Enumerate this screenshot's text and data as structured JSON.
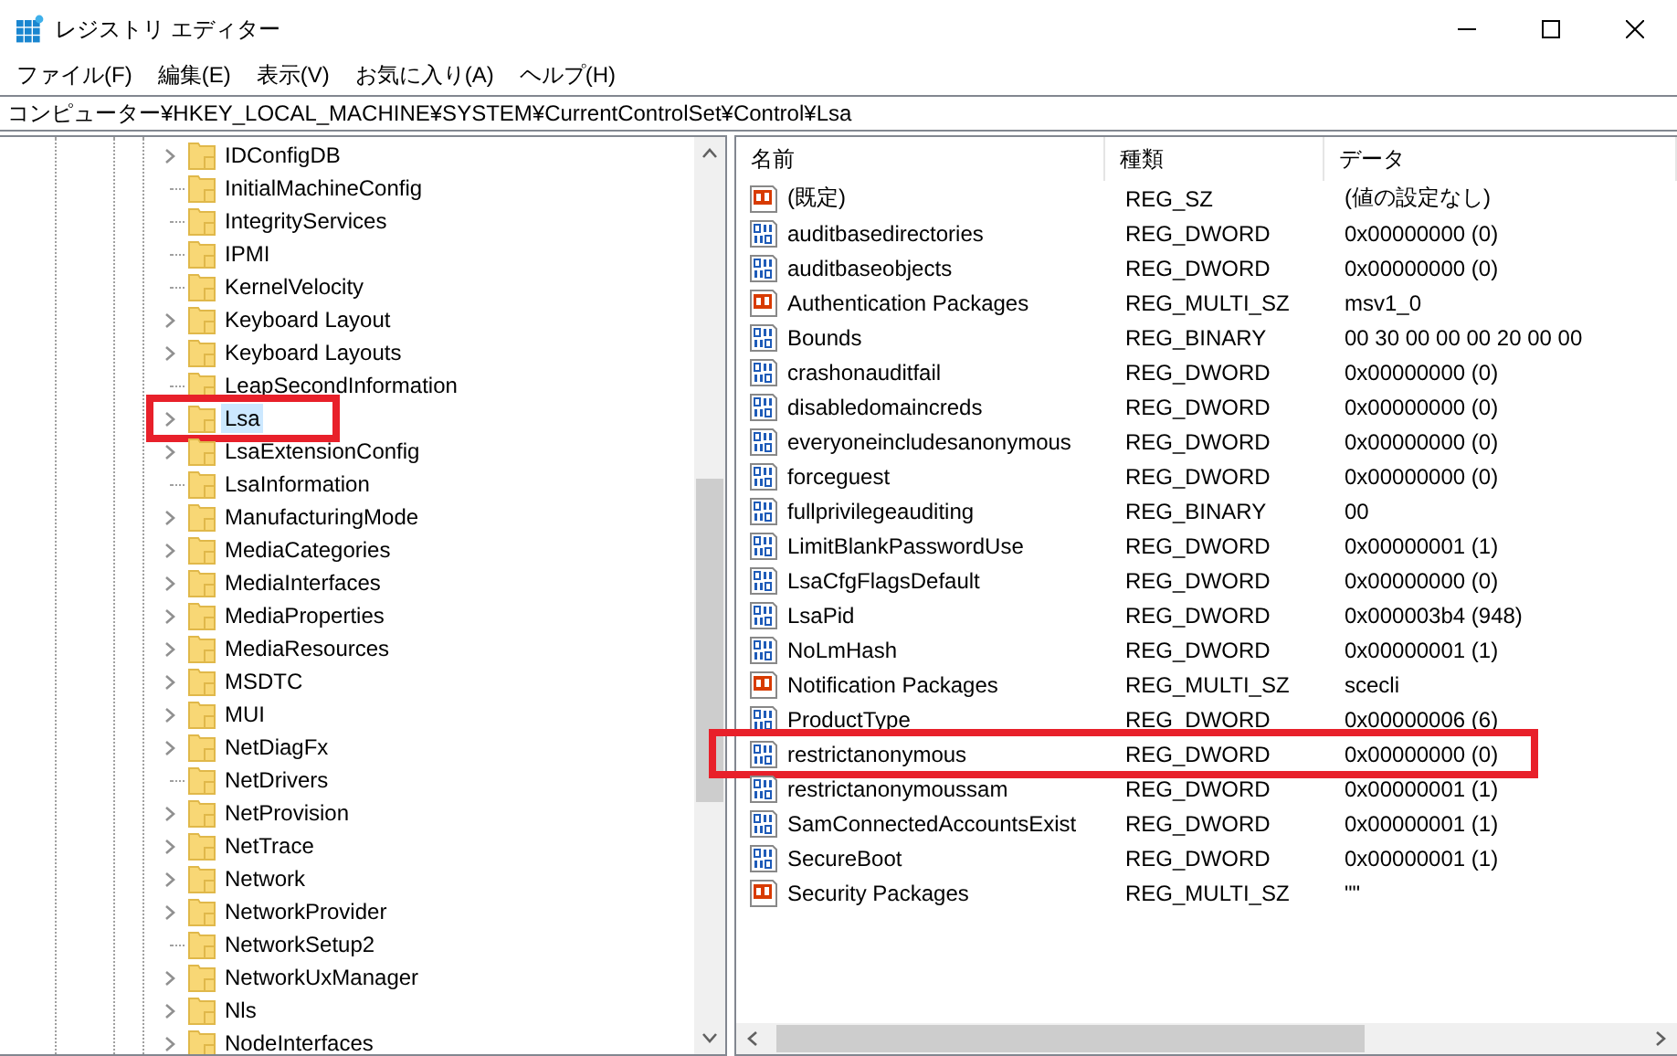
{
  "window": {
    "title": "レジストリ エディター"
  },
  "menu": [
    "ファイル(F)",
    "編集(E)",
    "表示(V)",
    "お気に入り(A)",
    "ヘルプ(H)"
  ],
  "address": "コンピューター¥HKEY_LOCAL_MACHINE¥SYSTEM¥CurrentControlSet¥Control¥Lsa",
  "tree": [
    {
      "label": "IDConfigDB",
      "expandable": true,
      "selected": false,
      "highlighted": false
    },
    {
      "label": "InitialMachineConfig",
      "expandable": false,
      "selected": false,
      "highlighted": false
    },
    {
      "label": "IntegrityServices",
      "expandable": false,
      "selected": false,
      "highlighted": false
    },
    {
      "label": "IPMI",
      "expandable": false,
      "selected": false,
      "highlighted": false
    },
    {
      "label": "KernelVelocity",
      "expandable": false,
      "selected": false,
      "highlighted": false
    },
    {
      "label": "Keyboard Layout",
      "expandable": true,
      "selected": false,
      "highlighted": false
    },
    {
      "label": "Keyboard Layouts",
      "expandable": true,
      "selected": false,
      "highlighted": false
    },
    {
      "label": "LeapSecondInformation",
      "expandable": false,
      "selected": false,
      "highlighted": false
    },
    {
      "label": "Lsa",
      "expandable": true,
      "selected": true,
      "highlighted": true
    },
    {
      "label": "LsaExtensionConfig",
      "expandable": true,
      "selected": false,
      "highlighted": false
    },
    {
      "label": "LsaInformation",
      "expandable": false,
      "selected": false,
      "highlighted": false
    },
    {
      "label": "ManufacturingMode",
      "expandable": true,
      "selected": false,
      "highlighted": false
    },
    {
      "label": "MediaCategories",
      "expandable": true,
      "selected": false,
      "highlighted": false
    },
    {
      "label": "MediaInterfaces",
      "expandable": true,
      "selected": false,
      "highlighted": false
    },
    {
      "label": "MediaProperties",
      "expandable": true,
      "selected": false,
      "highlighted": false
    },
    {
      "label": "MediaResources",
      "expandable": true,
      "selected": false,
      "highlighted": false
    },
    {
      "label": "MSDTC",
      "expandable": true,
      "selected": false,
      "highlighted": false
    },
    {
      "label": "MUI",
      "expandable": true,
      "selected": false,
      "highlighted": false
    },
    {
      "label": "NetDiagFx",
      "expandable": true,
      "selected": false,
      "highlighted": false
    },
    {
      "label": "NetDrivers",
      "expandable": false,
      "selected": false,
      "highlighted": false
    },
    {
      "label": "NetProvision",
      "expandable": true,
      "selected": false,
      "highlighted": false
    },
    {
      "label": "NetTrace",
      "expandable": true,
      "selected": false,
      "highlighted": false
    },
    {
      "label": "Network",
      "expandable": true,
      "selected": false,
      "highlighted": false
    },
    {
      "label": "NetworkProvider",
      "expandable": true,
      "selected": false,
      "highlighted": false
    },
    {
      "label": "NetworkSetup2",
      "expandable": false,
      "selected": false,
      "highlighted": false
    },
    {
      "label": "NetworkUxManager",
      "expandable": true,
      "selected": false,
      "highlighted": false
    },
    {
      "label": "Nls",
      "expandable": true,
      "selected": false,
      "highlighted": false
    },
    {
      "label": "NodeInterfaces",
      "expandable": true,
      "selected": false,
      "highlighted": false
    }
  ],
  "columns": [
    "名前",
    "種類",
    "データ"
  ],
  "values": [
    {
      "kind": "string",
      "name": "(既定)",
      "type": "REG_SZ",
      "data": "(値の設定なし)",
      "highlighted": false
    },
    {
      "kind": "binary",
      "name": "auditbasedirectories",
      "type": "REG_DWORD",
      "data": "0x00000000 (0)",
      "highlighted": false
    },
    {
      "kind": "binary",
      "name": "auditbaseobjects",
      "type": "REG_DWORD",
      "data": "0x00000000 (0)",
      "highlighted": false
    },
    {
      "kind": "string",
      "name": "Authentication Packages",
      "type": "REG_MULTI_SZ",
      "data": "msv1_0",
      "highlighted": false
    },
    {
      "kind": "binary",
      "name": "Bounds",
      "type": "REG_BINARY",
      "data": "00 30 00 00 00 20 00 00",
      "highlighted": false
    },
    {
      "kind": "binary",
      "name": "crashonauditfail",
      "type": "REG_DWORD",
      "data": "0x00000000 (0)",
      "highlighted": false
    },
    {
      "kind": "binary",
      "name": "disabledomaincreds",
      "type": "REG_DWORD",
      "data": "0x00000000 (0)",
      "highlighted": false
    },
    {
      "kind": "binary",
      "name": "everyoneincludesanonymous",
      "type": "REG_DWORD",
      "data": "0x00000000 (0)",
      "highlighted": false
    },
    {
      "kind": "binary",
      "name": "forceguest",
      "type": "REG_DWORD",
      "data": "0x00000000 (0)",
      "highlighted": false
    },
    {
      "kind": "binary",
      "name": "fullprivilegeauditing",
      "type": "REG_BINARY",
      "data": "00",
      "highlighted": false
    },
    {
      "kind": "binary",
      "name": "LimitBlankPasswordUse",
      "type": "REG_DWORD",
      "data": "0x00000001 (1)",
      "highlighted": false
    },
    {
      "kind": "binary",
      "name": "LsaCfgFlagsDefault",
      "type": "REG_DWORD",
      "data": "0x00000000 (0)",
      "highlighted": false
    },
    {
      "kind": "binary",
      "name": "LsaPid",
      "type": "REG_DWORD",
      "data": "0x000003b4 (948)",
      "highlighted": false
    },
    {
      "kind": "binary",
      "name": "NoLmHash",
      "type": "REG_DWORD",
      "data": "0x00000001 (1)",
      "highlighted": false
    },
    {
      "kind": "string",
      "name": "Notification Packages",
      "type": "REG_MULTI_SZ",
      "data": "scecli",
      "highlighted": false
    },
    {
      "kind": "binary",
      "name": "ProductType",
      "type": "REG_DWORD",
      "data": "0x00000006 (6)",
      "highlighted": false
    },
    {
      "kind": "binary",
      "name": "restrictanonymous",
      "type": "REG_DWORD",
      "data": "0x00000000 (0)",
      "highlighted": true
    },
    {
      "kind": "binary",
      "name": "restrictanonymoussam",
      "type": "REG_DWORD",
      "data": "0x00000001 (1)",
      "highlighted": false
    },
    {
      "kind": "binary",
      "name": "SamConnectedAccountsExist",
      "type": "REG_DWORD",
      "data": "0x00000001 (1)",
      "highlighted": false
    },
    {
      "kind": "binary",
      "name": "SecureBoot",
      "type": "REG_DWORD",
      "data": "0x00000001 (1)",
      "highlighted": false
    },
    {
      "kind": "string",
      "name": "Security Packages",
      "type": "REG_MULTI_SZ",
      "data": "\"\"",
      "highlighted": false
    }
  ]
}
